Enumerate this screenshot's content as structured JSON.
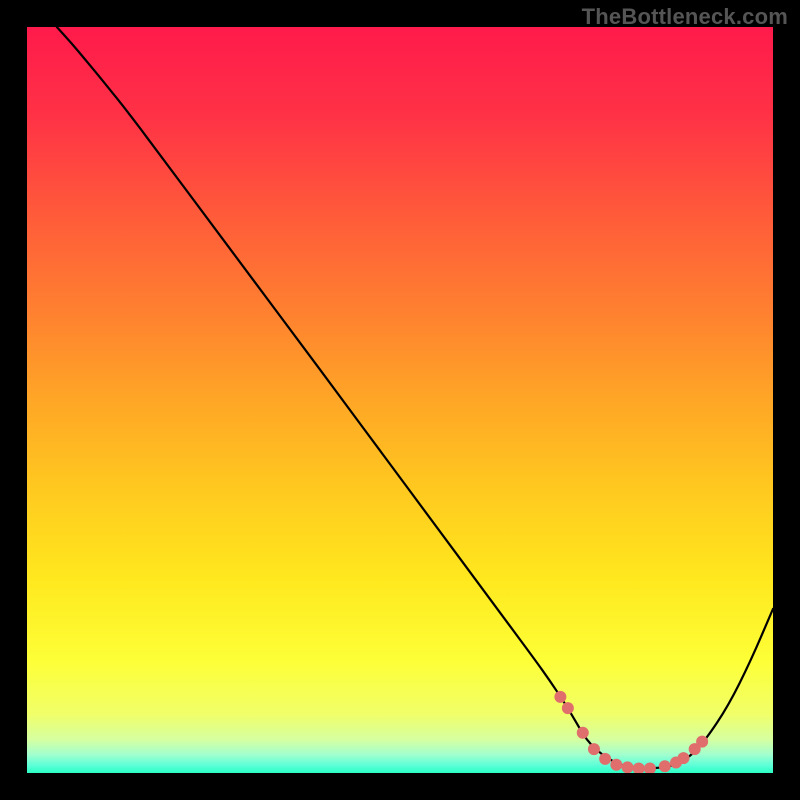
{
  "watermark": "TheBottleneck.com",
  "colors": {
    "marker": "#df6e6c",
    "curve": "#000000"
  },
  "gradient_stops": [
    {
      "offset": 0.0,
      "color": "#ff1a4b"
    },
    {
      "offset": 0.12,
      "color": "#ff3246"
    },
    {
      "offset": 0.25,
      "color": "#ff5a3a"
    },
    {
      "offset": 0.38,
      "color": "#ff8030"
    },
    {
      "offset": 0.5,
      "color": "#ffa626"
    },
    {
      "offset": 0.62,
      "color": "#ffc91f"
    },
    {
      "offset": 0.74,
      "color": "#ffe81e"
    },
    {
      "offset": 0.85,
      "color": "#fdff37"
    },
    {
      "offset": 0.92,
      "color": "#f1ff68"
    },
    {
      "offset": 0.955,
      "color": "#d6ffa0"
    },
    {
      "offset": 0.975,
      "color": "#a3ffce"
    },
    {
      "offset": 0.99,
      "color": "#5bffd8"
    },
    {
      "offset": 1.0,
      "color": "#2affc4"
    }
  ],
  "chart_data": {
    "type": "line",
    "title": "",
    "xlabel": "",
    "ylabel": "",
    "xlim": [
      0,
      100
    ],
    "ylim": [
      0,
      100
    ],
    "x": [
      4,
      6,
      8,
      10,
      14,
      18,
      24,
      30,
      36,
      42,
      48,
      54,
      60,
      64,
      68,
      70,
      72,
      73.5,
      75,
      77,
      79,
      81,
      83,
      85,
      87,
      89,
      91,
      94,
      97,
      100
    ],
    "y": [
      100,
      97.8,
      95.4,
      93,
      88,
      82.6,
      74.6,
      66.5,
      58.5,
      50.4,
      42.3,
      34.2,
      26.1,
      20.7,
      15.3,
      12.5,
      9.5,
      7,
      4.4,
      2.5,
      1.3,
      0.7,
      0.6,
      0.7,
      1.1,
      2.3,
      4.5,
      9,
      15,
      22
    ],
    "markers": {
      "x": [
        71.5,
        72.5,
        74.5,
        76,
        77.5,
        79,
        80.5,
        82,
        83.5,
        85.5,
        87,
        88,
        89.5,
        90.5
      ],
      "y": [
        10.2,
        8.7,
        5.4,
        3.2,
        1.9,
        1.1,
        0.75,
        0.6,
        0.6,
        0.9,
        1.4,
        2.0,
        3.2,
        4.2
      ]
    }
  }
}
